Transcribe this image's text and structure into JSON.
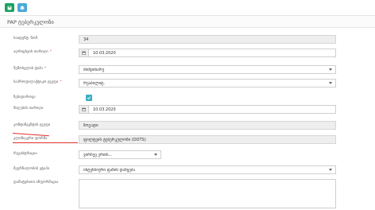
{
  "title": "PAP ტუბერკულოზი",
  "colors": {
    "save": "#1aa15f",
    "print": "#4aa8d8",
    "accent": "#3aaec0",
    "underline": "#e0302e"
  },
  "toolbar": {
    "save_icon": "floppy-disk-icon",
    "print_icon": "printer-icon"
  },
  "form": {
    "rows": [
      {
        "label": "საიდენტ. ნომ.",
        "required": false,
        "value": "34"
      },
      {
        "label": "აღრიცხვის თარიღი",
        "required": true,
        "value": "10.03.2020"
      },
      {
        "label": "შემოსვლის ტიპი",
        "required": true,
        "value": "მიმდინარე"
      },
      {
        "label": "საპროფილაქტიკო ჯგუფი",
        "required": true,
        "value": "რეაბილიტ."
      },
      {
        "label": "ნებადართვა",
        "required": false,
        "checked": true
      },
      {
        "label": "მიღების თარიღი",
        "required": false,
        "value": "10.03.2020"
      },
      {
        "label": "კონტინგენტის ჯგუფი",
        "required": false,
        "value": "ზოგადი"
      },
      {
        "label": "კლინიკური ფორმა",
        "required": false,
        "value": "ფილტვის ტუბერკულოზი (DOTS)"
      },
      {
        "label": "რეგისტრაცია",
        "required": false,
        "value": "ვირჩევ ერთს..."
      },
      {
        "label": "მკურნალობის ეტაპი",
        "required": false,
        "value": "ინტენსიური ფაზის დაწყება"
      },
      {
        "label": "დამატებითი ინფორმაცია",
        "required": false,
        "value": ""
      }
    ]
  }
}
